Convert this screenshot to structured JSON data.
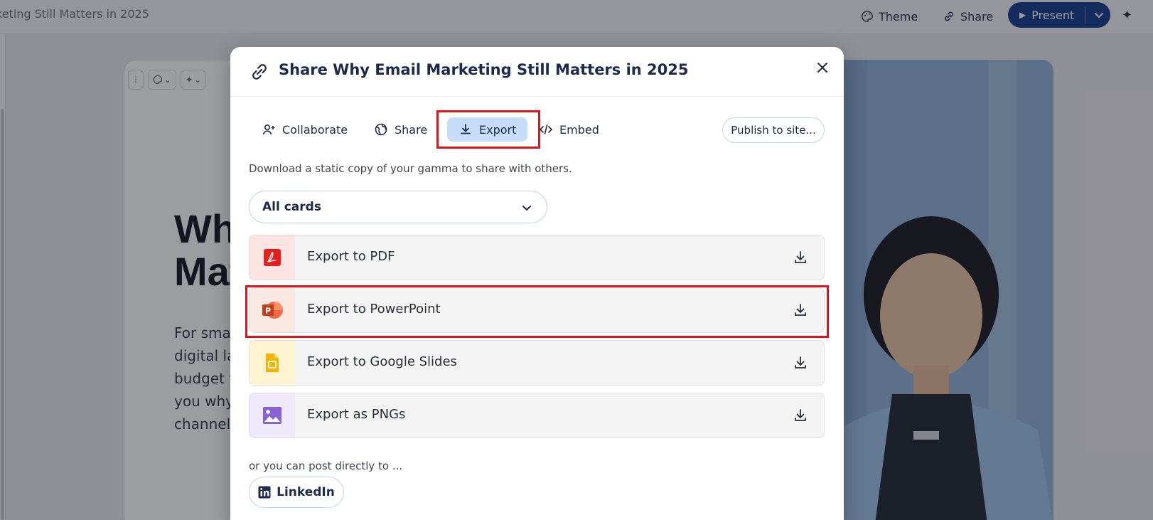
{
  "topbar": {
    "doc_title": "keting Still Matters in 2025",
    "theme_label": "Theme",
    "share_label": "Share",
    "present_label": "Present"
  },
  "card": {
    "heading": "Wh\nMat",
    "body": "For smal\ndigital lar\nbudget t\nyou why\nchannel"
  },
  "modal": {
    "title": "Share Why Email Marketing Still Matters in 2025",
    "tabs": [
      {
        "label": "Collaborate",
        "icon": "add-user-icon"
      },
      {
        "label": "Share",
        "icon": "globe-icon"
      },
      {
        "label": "Export",
        "icon": "download-icon",
        "active": true
      },
      {
        "label": "Embed",
        "icon": "code-icon"
      }
    ],
    "publish_label": "Publish to site...",
    "description": "Download a static copy of your gamma to share with others.",
    "select": {
      "value": "All cards"
    },
    "export_options": [
      {
        "label": "Export to PDF",
        "icon": "pdf-icon",
        "tint": "#fbe4e2"
      },
      {
        "label": "Export to PowerPoint",
        "icon": "powerpoint-icon",
        "tint": "#fbe7e2"
      },
      {
        "label": "Export to Google Slides",
        "icon": "google-slides-icon",
        "tint": "#fff3d1"
      },
      {
        "label": "Export as PNGs",
        "icon": "image-icon",
        "tint": "#efeaf9"
      }
    ],
    "post_text": "or you can post directly to ...",
    "linkedin_label": "LinkedIn"
  },
  "colors": {
    "accent": "#153c8c",
    "active_tab": "#c7dcf8",
    "highlight": "#e0141a"
  }
}
